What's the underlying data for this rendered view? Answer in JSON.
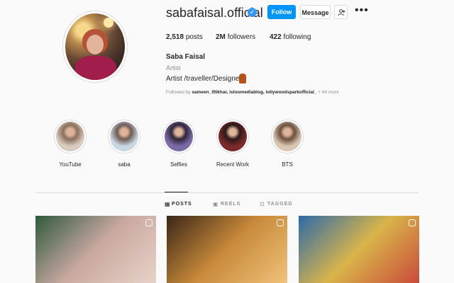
{
  "profile": {
    "username": "sabafaisal.official",
    "verified_glyph": "✓",
    "follow_label": "Follow",
    "message_label": "Message",
    "more_glyph": "•••",
    "posts_count": "2,518",
    "posts_label": "posts",
    "followers_count": "2M",
    "followers_label": "followers",
    "following_count": "422",
    "following_label": "following",
    "full_name": "Saba Faisal",
    "category": "Artist",
    "bio": "Artist /traveller/Designer",
    "followed_by_prefix": "Followed by",
    "followed_by_names": "sameen_iftikhar, isloomediablog, lollywoodsparkofficial_",
    "followed_by_more": "+ 66 more"
  },
  "highlights": [
    {
      "label": "YouTube",
      "icon": "highlight-youtube",
      "colors": [
        "#d8cbbf",
        "#8a6f5c"
      ]
    },
    {
      "label": "saba",
      "icon": "highlight-saba",
      "colors": [
        "#c9d8e2",
        "#6d5a55"
      ]
    },
    {
      "label": "Selfies",
      "icon": "highlight-selfies",
      "colors": [
        "#7b6aa8",
        "#2e2638"
      ]
    },
    {
      "label": "Recent Work",
      "icon": "highlight-recent-work",
      "colors": [
        "#7a2a2a",
        "#2b1a18"
      ]
    },
    {
      "label": "BTS",
      "icon": "highlight-bts",
      "colors": [
        "#d9c7b4",
        "#6b4f3c"
      ]
    }
  ],
  "tabs": [
    {
      "label": "POSTS",
      "icon": "grid-icon",
      "active": true
    },
    {
      "label": "REELS",
      "icon": "reels-icon",
      "active": false
    },
    {
      "label": "TAGGED",
      "icon": "tagged-icon",
      "active": false
    }
  ],
  "posts": [
    {
      "icon": "reel-badge-icon",
      "colors": [
        "#2f5a3c",
        "#c9a9a2",
        "#e8d3c9"
      ]
    },
    {
      "icon": "multi-photo-badge-icon",
      "colors": [
        "#3a2618",
        "#c98a3a",
        "#f0c27a"
      ]
    },
    {
      "icon": "reel-badge-icon",
      "colors": [
        "#2d6aa8",
        "#d9b44a",
        "#c94a3a"
      ]
    }
  ],
  "colors": {
    "accent": "#0095f6",
    "verified": "#3897f0",
    "muted_text": "#8e8e8e",
    "border": "#dbdbdb",
    "background": "#fafafa"
  }
}
